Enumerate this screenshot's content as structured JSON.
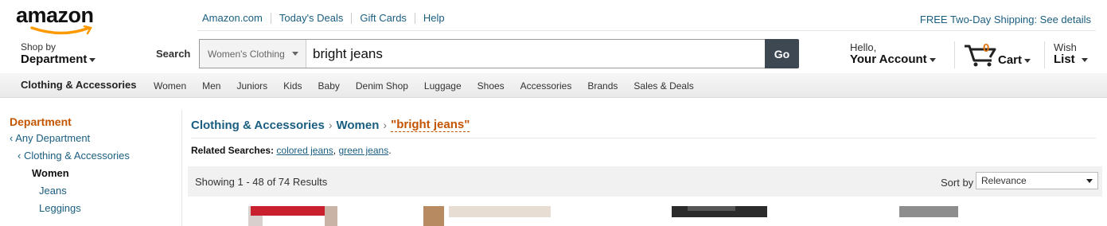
{
  "logo": {
    "text": "amazon"
  },
  "topnav": {
    "links": [
      "Amazon.com",
      "Today's Deals",
      "Gift Cards",
      "Help"
    ],
    "shipping": "FREE Two-Day Shipping: See details"
  },
  "header": {
    "shop_small": "Shop by",
    "shop_big": "Department",
    "search_label": "Search",
    "scope": "Women's Clothing",
    "search_value": "bright jeans",
    "go": "Go",
    "hello": "Hello,",
    "account": "Your Account",
    "cart_count": "0",
    "cart": "Cart",
    "wish_small": "Wish",
    "wish_big": "List"
  },
  "catbar": {
    "title": "Clothing & Accessories",
    "links": [
      "Women",
      "Men",
      "Juniors",
      "Kids",
      "Baby",
      "Denim Shop",
      "Luggage",
      "Shoes",
      "Accessories",
      "Brands",
      "Sales & Deals"
    ]
  },
  "sidebar": {
    "department": "Department",
    "any": "‹ Any Department",
    "clothing": "‹ Clothing & Accessories",
    "women": "Women",
    "sub": [
      "Jeans",
      "Leggings"
    ]
  },
  "breadcrumb": {
    "level1": "Clothing & Accessories",
    "level2": "Women",
    "query": "\"bright jeans\"",
    "sep": "›"
  },
  "related": {
    "label": "Related Searches:",
    "links": [
      "colored jeans",
      "green jeans"
    ],
    "sep": ",",
    "end": "."
  },
  "results": {
    "count": "Showing 1 - 48 of 74 Results",
    "sort_label": "Sort by",
    "sort_value": "Relevance"
  },
  "colors": {
    "link": "#1a5e80",
    "accent": "#c45500",
    "go_button": "#3d4853",
    "cart_count": "#e47911"
  }
}
